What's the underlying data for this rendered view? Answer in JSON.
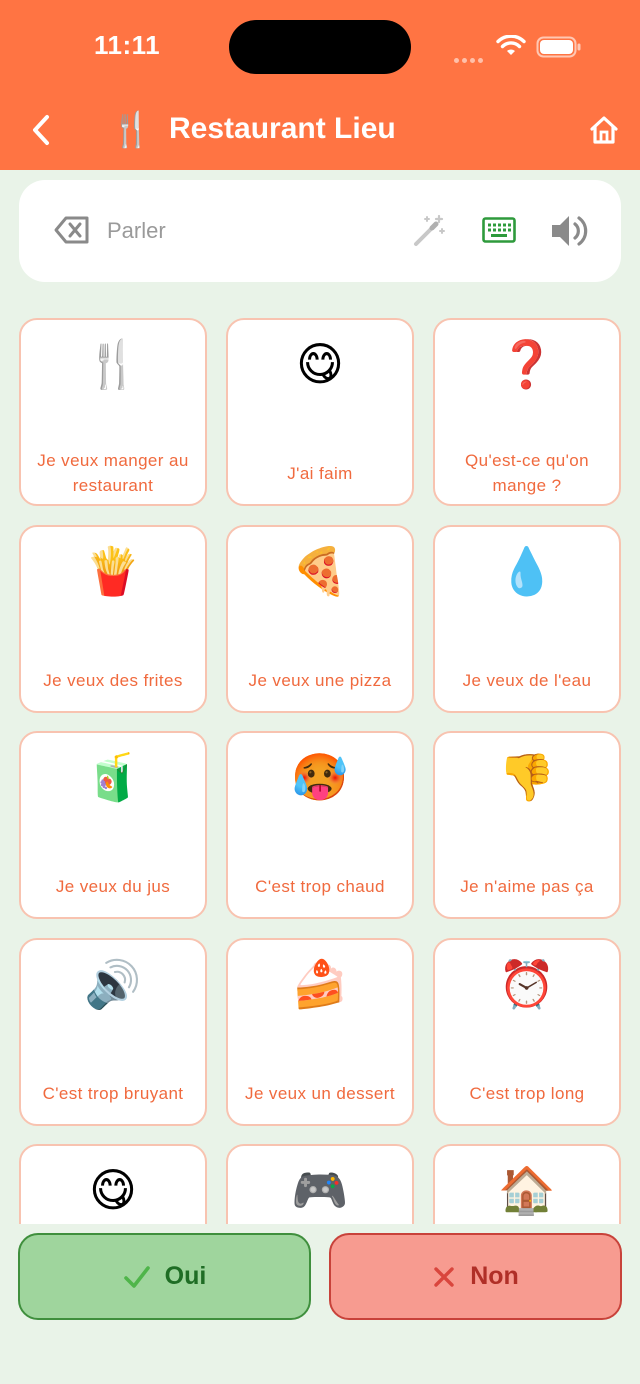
{
  "status_bar": {
    "time": "11:11"
  },
  "nav": {
    "title": "Restaurant Lieu",
    "category_icon": "🍴"
  },
  "speak_bar": {
    "placeholder": "Parler"
  },
  "colors": {
    "header": "#ff7443",
    "background": "#e9f3e8",
    "card_border": "#f8c3b0",
    "card_text": "#f06a3e",
    "yes": "#9fd59d",
    "no": "#f79b90"
  },
  "cards": [
    {
      "emoji": "🍴",
      "label": "Je veux manger au restaurant"
    },
    {
      "emoji": "😋",
      "label": "J'ai faim"
    },
    {
      "emoji": "❓",
      "label": "Qu'est-ce qu'on mange ?"
    },
    {
      "emoji": "🍟",
      "label": "Je veux des frites"
    },
    {
      "emoji": "🍕",
      "label": "Je veux une pizza"
    },
    {
      "emoji": "💧",
      "label": "Je veux de l'eau"
    },
    {
      "emoji": "🧃",
      "label": "Je veux du jus"
    },
    {
      "emoji": "🥵",
      "label": "C'est trop chaud"
    },
    {
      "emoji": "👎",
      "label": "Je n'aime pas ça"
    },
    {
      "emoji": "🔊",
      "label": "C'est trop bruyant"
    },
    {
      "emoji": "🍰",
      "label": "Je veux un dessert"
    },
    {
      "emoji": "⏰",
      "label": "C'est trop long"
    },
    {
      "emoji": "😋",
      "label": ""
    },
    {
      "emoji": "🎮",
      "label": ""
    },
    {
      "emoji": "🏠",
      "label": ""
    }
  ],
  "buttons": {
    "yes": "Oui",
    "no": "Non"
  }
}
